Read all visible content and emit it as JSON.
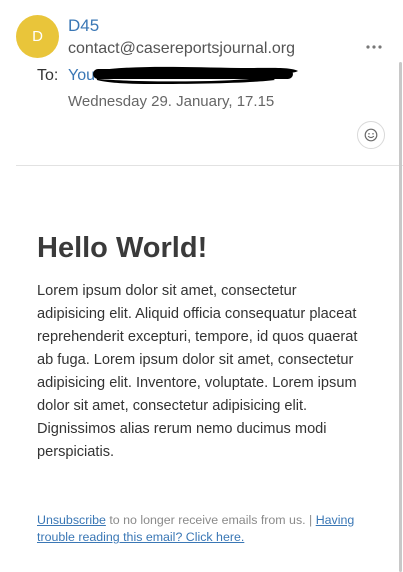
{
  "email": {
    "sender": {
      "initial": "D",
      "name": "D45",
      "address": "contact@casereportsjournal.org",
      "avatar_color": "#e9c53a"
    },
    "recipient": {
      "label": "To:",
      "name": "You"
    },
    "date": "Wednesday 29. January, 17.15",
    "accent_color": "#3a77b5",
    "icons": {
      "more": "more-horizontal-icon",
      "react": "smiley-icon"
    }
  },
  "content": {
    "heading": "Hello World!",
    "paragraph": "Lorem ipsum dolor sit amet, consectetur adipisicing elit. Aliquid officia consequatur placeat reprehenderit excepturi, tempore, id quos quaerat ab fuga. Lorem ipsum dolor sit amet, consectetur adipisicing elit. Inventore, voluptate. Lorem ipsum dolor sit amet, consectetur adipisicing elit. Dignissimos alias rerum nemo ducimus modi perspiciatis."
  },
  "footer": {
    "unsubscribe_link": "Unsubscribe",
    "unsubscribe_text": " to no longer receive emails from us. | ",
    "view_online_link": "Having trouble reading this email? Click here."
  }
}
